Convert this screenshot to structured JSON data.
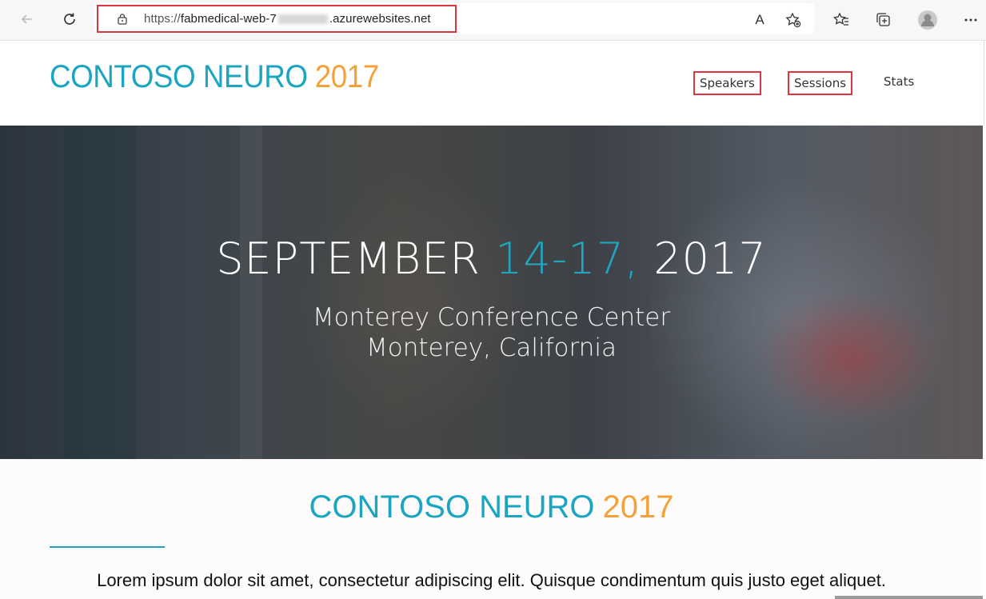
{
  "browser": {
    "url_protocol": "https://",
    "url_host_start": "fabmedical-web-7",
    "url_host_end": ".azurewebsites.net",
    "read_aloud_label": "A"
  },
  "site": {
    "logo_text": "CONTOSO NEURO",
    "logo_year": "2017",
    "nav": [
      "Speakers",
      "Sessions",
      "Stats"
    ]
  },
  "hero": {
    "month": "SEPTEMBER",
    "dates": "14-17,",
    "year": "2017",
    "venue": "Monterey Conference Center",
    "city": "Monterey, California"
  },
  "content": {
    "title": "CONTOSO NEURO",
    "title_year": "2017",
    "lorem": "Lorem ipsum dolor sit amet, consectetur adipiscing elit. Quisque condimentum quis justo eget aliquet."
  },
  "colors": {
    "brand_teal": "#1aa6c0",
    "brand_orange": "#f3a23a",
    "highlight_red": "#d9363e"
  }
}
